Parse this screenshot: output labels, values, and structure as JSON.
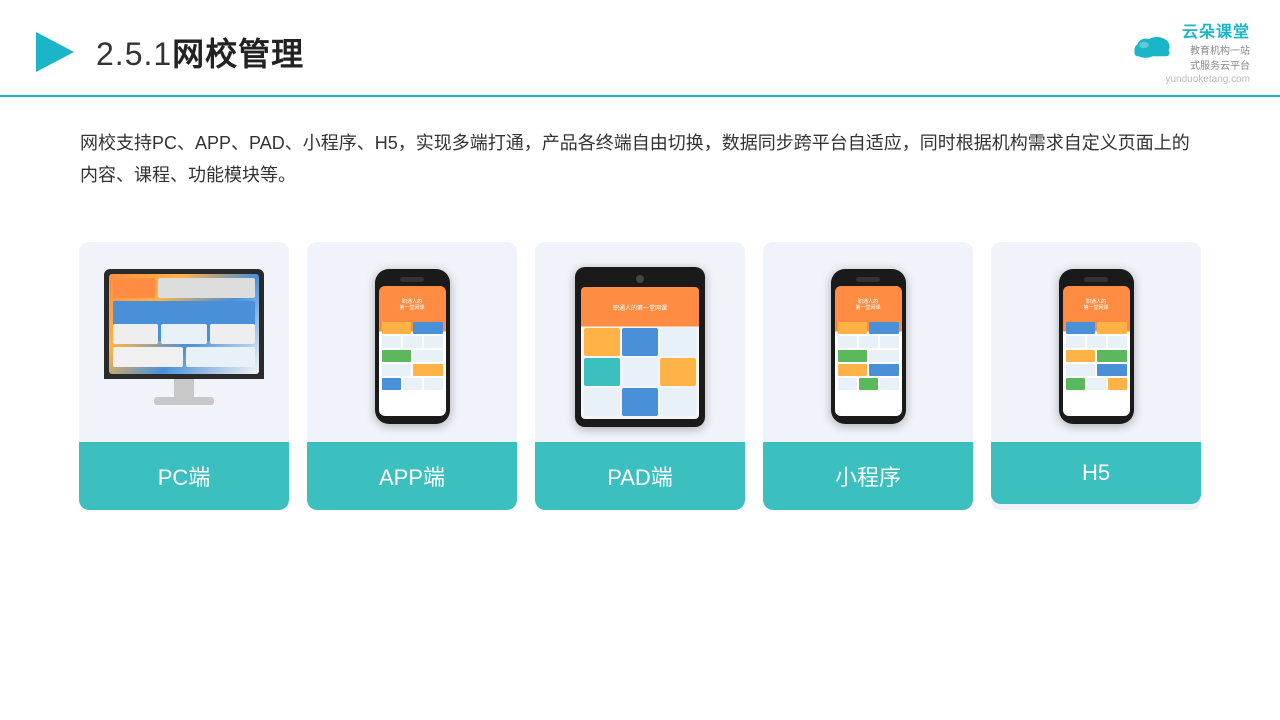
{
  "header": {
    "section_number": "2.5.1",
    "title": "网校管理",
    "logo": {
      "name": "云朵课堂",
      "url": "yunduoketang.com",
      "tagline": "教育机构一站",
      "tagline2": "式服务云平台"
    }
  },
  "description": {
    "text": "网校支持PC、APP、PAD、小程序、H5，实现多端打通，产品各终端自由切换，数据同步跨平台自适应，同时根据机构需求自定义页面上的内容、课程、功能模块等。"
  },
  "cards": [
    {
      "id": "pc",
      "label": "PC端"
    },
    {
      "id": "app",
      "label": "APP端"
    },
    {
      "id": "pad",
      "label": "PAD端"
    },
    {
      "id": "miniapp",
      "label": "小程序"
    },
    {
      "id": "h5",
      "label": "H5"
    }
  ],
  "colors": {
    "teal": "#3cbfbf",
    "accent": "#1ab5c8",
    "card_bg": "#eef2fa",
    "title": "#222222"
  }
}
